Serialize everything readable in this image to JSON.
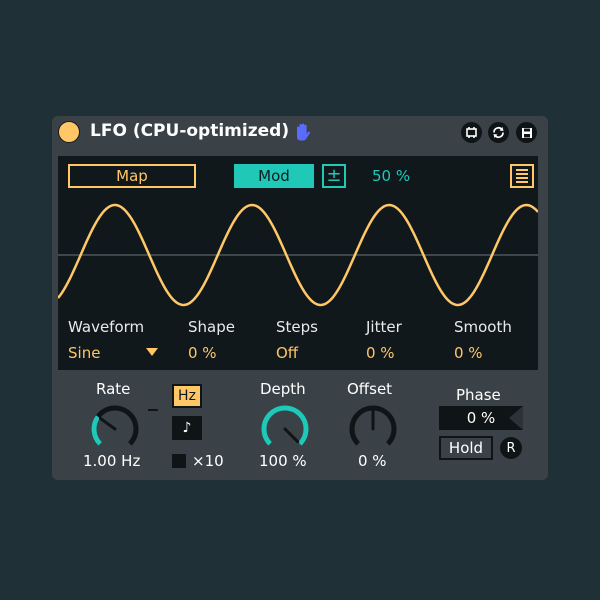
{
  "device": {
    "title": "LFO (CPU-optimized)",
    "icons": [
      "hand-icon",
      "sync-icon",
      "refresh-icon",
      "save-icon"
    ]
  },
  "display": {
    "map_label": "Map",
    "mod_label": "Mod",
    "plusminus_label": "±",
    "mod_amount": "50 %",
    "params": [
      {
        "label": "Waveform",
        "value": "Sine"
      },
      {
        "label": "Shape",
        "value": "0 %"
      },
      {
        "label": "Steps",
        "value": "Off"
      },
      {
        "label": "Jitter",
        "value": "0 %"
      },
      {
        "label": "Smooth",
        "value": "0 %"
      }
    ]
  },
  "controls": {
    "rate": {
      "label": "Rate",
      "value": "1.00 Hz",
      "level": 0.3
    },
    "hz_label": "Hz",
    "note_label": "♪",
    "x10_label": "×10",
    "depth": {
      "label": "Depth",
      "value": "100 %",
      "level": 1.0
    },
    "offset": {
      "label": "Offset",
      "value": "0 %",
      "level": 0.5
    },
    "phase": {
      "label": "Phase",
      "value": "0 %"
    },
    "hold_label": "Hold",
    "r_label": "R"
  },
  "colors": {
    "accent": "#ffc766",
    "teal": "#1fc8b7",
    "panel": "#3a4248",
    "display": "#11181c"
  }
}
